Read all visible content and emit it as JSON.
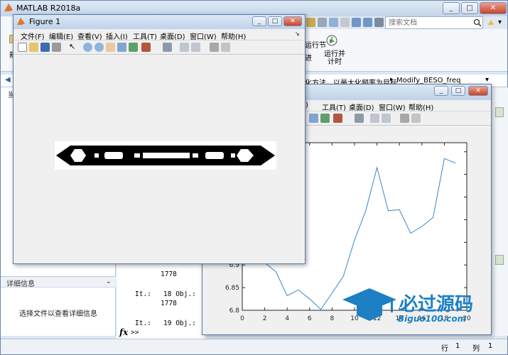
{
  "app": {
    "title": "MATLAB R2018a",
    "search_placeholder": "搜索文档",
    "toolstrip_run_section": "运行节",
    "toolstrip_advance": "进",
    "toolstrip_runtime": "运行并\n计时",
    "left_partial_label": "新",
    "path_text": "化方法，以最大化频率为目标",
    "path_folder": "Modify_BESO_freq",
    "left_panel_header_char": "当",
    "detail_header": "详细信息",
    "detail_hint": "选择文件以查看详细信息",
    "status_row_label": "行",
    "status_row_value": "1",
    "status_col_label": "列",
    "status_col_value": "1"
  },
  "command_window": {
    "lines": [
      {
        "text": "1778",
        "indent": true
      },
      {
        "text": "It.:   18 Obj.:",
        "indent": false
      },
      {
        "text": "1778",
        "indent": true
      },
      {
        "text": "It.:   19 Obj.:",
        "indent": false
      }
    ],
    "prompt": ">>",
    "fx": "fx"
  },
  "figure1": {
    "title": "Figure 1",
    "menu": [
      "文件(F)",
      "编辑(E)",
      "查看(V)",
      "插入(I)",
      "工具(T)",
      "桌面(D)",
      "窗口(W)",
      "帮助(H)"
    ]
  },
  "figure2": {
    "menu": [
      "(I)",
      "工具(T)",
      "桌面(D)",
      "窗口(W)",
      "帮助(H)"
    ]
  },
  "chart_data": {
    "type": "line",
    "title": "",
    "xlabel": "",
    "ylabel": "",
    "xlim": [
      0,
      20
    ],
    "x": [
      1,
      2,
      3,
      4,
      5,
      6,
      7,
      8,
      9,
      10,
      11,
      12,
      13,
      14,
      15,
      16,
      17,
      18,
      19,
      20
    ],
    "y": [
      6.905,
      6.905,
      6.885,
      6.832,
      6.845,
      6.825,
      6.802,
      6.838,
      6.875,
      6.955,
      7.02,
      7.115,
      7.02,
      7.022,
      6.97,
      6.985,
      7.005,
      7.135,
      7.125,
      null
    ],
    "xticks": [
      0,
      2,
      4,
      6,
      8,
      10,
      12,
      14,
      16,
      18,
      20
    ],
    "yticks_visible": [
      "6.8",
      "6.85",
      "6.9"
    ],
    "series_color": "#3a86c8"
  },
  "watermark": {
    "text_cn": "必过源码",
    "text_url": "Biguo100.com"
  }
}
